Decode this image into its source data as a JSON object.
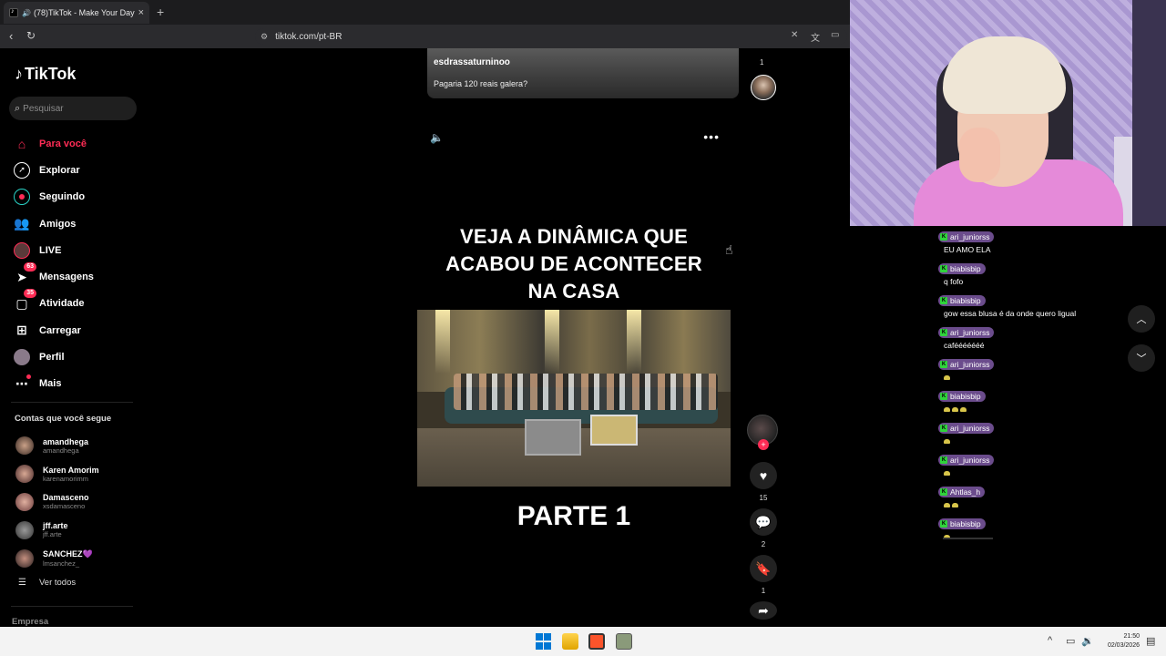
{
  "browser": {
    "tab_title": "(78)TikTok - Make Your Day",
    "tab_close": "×",
    "new_tab": "+",
    "url": "tiktok.com/pt-BR"
  },
  "sidebar": {
    "logo": "TikTok",
    "search_placeholder": "Pesquisar",
    "menu": [
      {
        "label": "Para você",
        "icon": "home-icon"
      },
      {
        "label": "Explorar",
        "icon": "compass-icon"
      },
      {
        "label": "Seguindo",
        "icon": "following-icon"
      },
      {
        "label": "Amigos",
        "icon": "friends-icon"
      },
      {
        "label": "LIVE",
        "icon": "live-icon"
      },
      {
        "label": "Mensagens",
        "icon": "messages-icon",
        "badge": "63"
      },
      {
        "label": "Atividade",
        "icon": "activity-icon",
        "badge": "35"
      },
      {
        "label": "Carregar",
        "icon": "upload-icon"
      },
      {
        "label": "Perfil",
        "icon": "profile-icon"
      },
      {
        "label": "Mais",
        "icon": "more-icon"
      }
    ],
    "following_title": "Contas que você segue",
    "following": [
      {
        "name": "amandhega",
        "handle": "amandhega"
      },
      {
        "name": "Karen Amorim",
        "handle": "karenamorimm"
      },
      {
        "name": "Damasceno",
        "handle": "xsdamasceno"
      },
      {
        "name": "jff.arte",
        "handle": "jff.arte"
      },
      {
        "name": "SANCHEZ💜",
        "handle": "lmsanchez_"
      }
    ],
    "see_all": "Ver todos",
    "footer": "Empresa"
  },
  "previous_post": {
    "author": "esdrassaturninoo",
    "caption": "Pagaria 120 reais galera?",
    "count": "1"
  },
  "video": {
    "headline": [
      "VEJA A DINÂMICA QUE",
      "ACABOU DE ACONTECER",
      "NA CASA"
    ],
    "subtitle": "PARTE 1",
    "likes": "15",
    "comments": "2",
    "saves": "1"
  },
  "chat": [
    {
      "user": "ari_juniorss",
      "text": "EU AMO ELA"
    },
    {
      "user": "biabisbip",
      "text": "q fofo"
    },
    {
      "user": "biabisbip",
      "text": "gow essa blusa é da onde quero ligual"
    },
    {
      "user": "ari_juniorss",
      "text": "cafééééééé"
    },
    {
      "user": "ari_juniorss",
      "emotes": 1
    },
    {
      "user": "biabisbip",
      "emotes": 3
    },
    {
      "user": "ari_juniorss",
      "emotes": 1
    },
    {
      "user": "ari_juniorss",
      "emotes": 1
    },
    {
      "user": "Ahtlas_h",
      "emotes": 2
    },
    {
      "user": "biabisbip",
      "emotes": 1
    }
  ],
  "taskbar": {
    "time": "21:50",
    "date": "02/03/2026"
  },
  "colors": {
    "accent": "#fe2c55",
    "chat_badge": "#6b4c8c",
    "kick_green": "#2fd33b"
  }
}
